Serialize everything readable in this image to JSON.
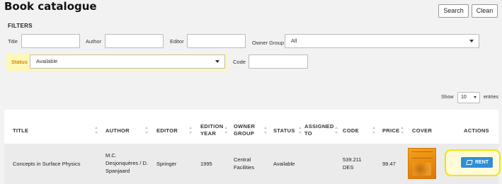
{
  "header": {
    "title": "Book catalogue",
    "search_label": "Search",
    "clean_label": "Clean"
  },
  "filters": {
    "heading": "FILTERS",
    "title_label": "Title",
    "author_label": "Author",
    "editor_label": "Editor",
    "owner_group_label": "Owner Group",
    "owner_group_value": "All",
    "status_label": "Status",
    "status_value": "Available",
    "code_label": "Code"
  },
  "length": {
    "show_label": "Show",
    "value": "10",
    "entries_label": "entries"
  },
  "table": {
    "columns": [
      "TITLE",
      "AUTHOR",
      "EDITOR",
      "EDITION YEAR",
      "OWNER GROUP",
      "STATUS",
      "ASSIGNED TO",
      "CODE",
      "PRICE",
      "COVER",
      "ACTIONS"
    ],
    "rows": [
      {
        "title": "Concepts in Surface Physics",
        "author": "M.C. Desjonquères / D. Spanjaard",
        "editor": "Springer",
        "edition_year": "1995",
        "owner_group": "Central Facilities",
        "status": "Available",
        "assigned_to": "",
        "code": "539.211 DES",
        "price": "99.47",
        "action_label": "RENT"
      }
    ]
  },
  "colors": {
    "accent": "#2f8ed8",
    "highlight": "#f2e600",
    "status_label": "#d08a00",
    "cover": "#f7a21a"
  }
}
